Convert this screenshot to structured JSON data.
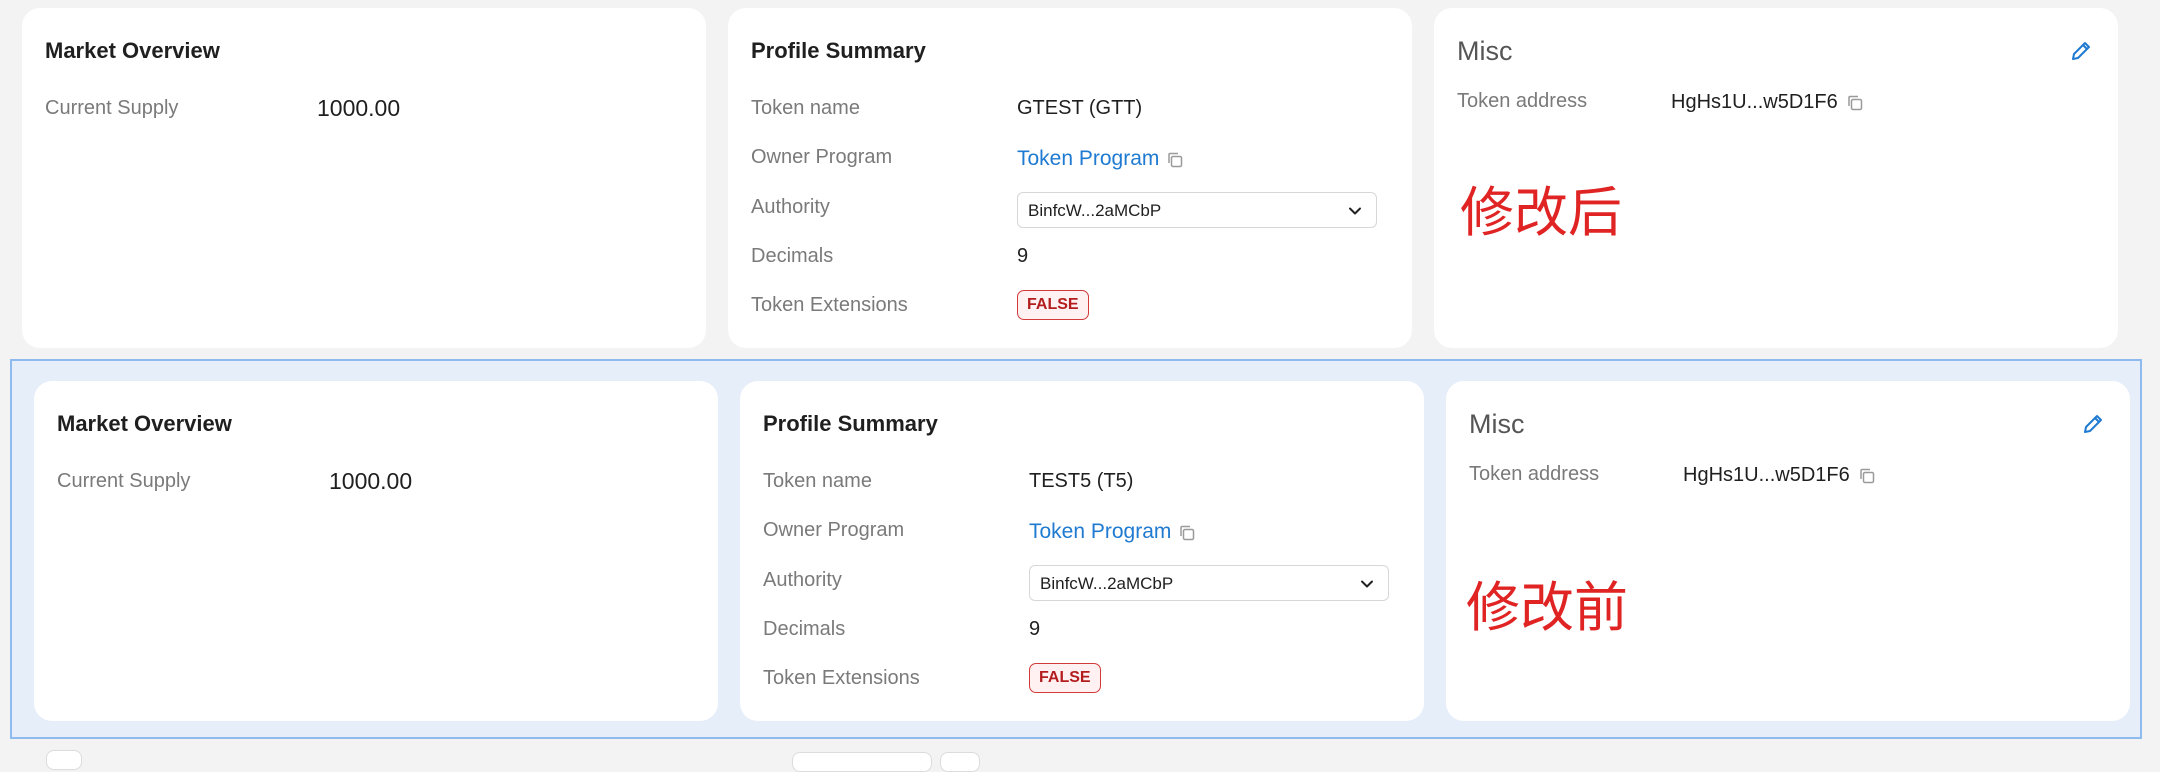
{
  "after": {
    "market": {
      "title": "Market Overview",
      "current_supply_label": "Current Supply",
      "current_supply_value": "1000.00"
    },
    "profile": {
      "title": "Profile Summary",
      "token_name_label": "Token name",
      "token_name_value": "GTEST (GTT)",
      "owner_program_label": "Owner Program",
      "owner_program_value": "Token Program",
      "authority_label": "Authority",
      "authority_value": "BinfcW...2aMCbP",
      "decimals_label": "Decimals",
      "decimals_value": "9",
      "extensions_label": "Token Extensions",
      "extensions_value": "FALSE"
    },
    "misc": {
      "title": "Misc",
      "token_address_label": "Token address",
      "token_address_value": "HgHs1U...w5D1F6"
    },
    "annotation": "修改后"
  },
  "before": {
    "market": {
      "title": "Market Overview",
      "current_supply_label": "Current Supply",
      "current_supply_value": "1000.00"
    },
    "profile": {
      "title": "Profile Summary",
      "token_name_label": "Token name",
      "token_name_value": "TEST5 (T5)",
      "owner_program_label": "Owner Program",
      "owner_program_value": "Token Program",
      "authority_label": "Authority",
      "authority_value": "BinfcW...2aMCbP",
      "decimals_label": "Decimals",
      "decimals_value": "9",
      "extensions_label": "Token Extensions",
      "extensions_value": "FALSE"
    },
    "misc": {
      "title": "Misc",
      "token_address_label": "Token address",
      "token_address_value": "HgHs1U...w5D1F6"
    },
    "annotation": "修改前"
  },
  "icons": {
    "copy": "copy-icon",
    "edit": "pencil-icon",
    "chevron": "chevron-down-icon"
  },
  "colors": {
    "background": "#f3f3f4",
    "card": "#ffffff",
    "link": "#1f7ad1",
    "badge_border": "#d23a3a",
    "badge_text": "#b31d1d",
    "annotation": "#e02424",
    "selection": "#8fbaf0"
  }
}
